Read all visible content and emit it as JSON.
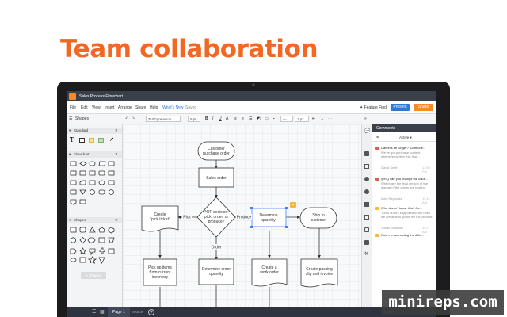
{
  "headline": "Team collaboration",
  "app": {
    "doc_title": "Sales Process Flowchart"
  },
  "menu": [
    "File",
    "Edit",
    "View",
    "Insert",
    "Arrange",
    "Share",
    "Help",
    "What's New",
    "Saved"
  ],
  "actions": {
    "feature_find": "Feature Find",
    "present": "Present",
    "share": "Share"
  },
  "toolbar": {
    "shapes": "Shapes",
    "font": "TcXGyreHeros",
    "font_size": "8 pt",
    "bold": "B",
    "italic": "I",
    "underline": "U",
    "align": "A",
    "line_width": "1 px"
  },
  "left_panel": {
    "sections": [
      {
        "name": "Standard"
      },
      {
        "name": "Flowchart"
      },
      {
        "name": "Shapes"
      }
    ],
    "more_shapes": "+ Shapes"
  },
  "flowchart": {
    "nodes": {
      "customer_po": [
        "Customer",
        "purchase order"
      ],
      "sales_order": [
        "Sales order"
      ],
      "decision": [
        "POF decision:",
        "pick, order, or",
        "produce?"
      ],
      "pick_ticket": [
        "Create",
        "\"pick ticket\""
      ],
      "determine_qty": [
        "Determine",
        "quantity"
      ],
      "ship": [
        "Ship to",
        "customer"
      ],
      "pick_items": [
        "Pick up items",
        "from current",
        "inventory"
      ],
      "order_qty": [
        "Determine order",
        "quantity"
      ],
      "work_order": [
        "Create a",
        "work order"
      ],
      "packing": [
        "Create packing",
        "slip and invoice"
      ]
    },
    "edges": {
      "pick": "Pick",
      "produce": "Produce",
      "order": "Order"
    }
  },
  "comments": {
    "title": "Comments",
    "filter": "Active ▾",
    "items": [
      {
        "title": "Can this be longer? Someone...",
        "text": "We've got purchase context whenever written this flow...",
        "author": "David Smith",
        "time": "12:59 PM"
      },
      {
        "title": "@RQ can you change the color...",
        "text": "Where are the final version of the diagram? the colors are looking.",
        "author": "Mike Reynolds",
        "time": "11:44 AM"
      },
      {
        "title": "Who doesn't know this? Co...",
        "text": "Turns out it's supposed to the rules we are able to go for the full process",
        "author": "Susan Johnson",
        "time": "11:21 AM"
      },
      {
        "title": "Room is connecting the diffe...",
        "text": "",
        "author": "",
        "time": ""
      }
    ]
  },
  "status_bar": {
    "page": "Page 1",
    "source": "Source",
    "zoom": "100%"
  },
  "watermark": "minireps.com",
  "colors": {
    "accent_orange": "#f26722",
    "present_blue": "#2b7bd6",
    "share_orange": "#f28c28",
    "titlebar": "#3a3f4a",
    "laptop_frame": "#1c1c1e"
  }
}
